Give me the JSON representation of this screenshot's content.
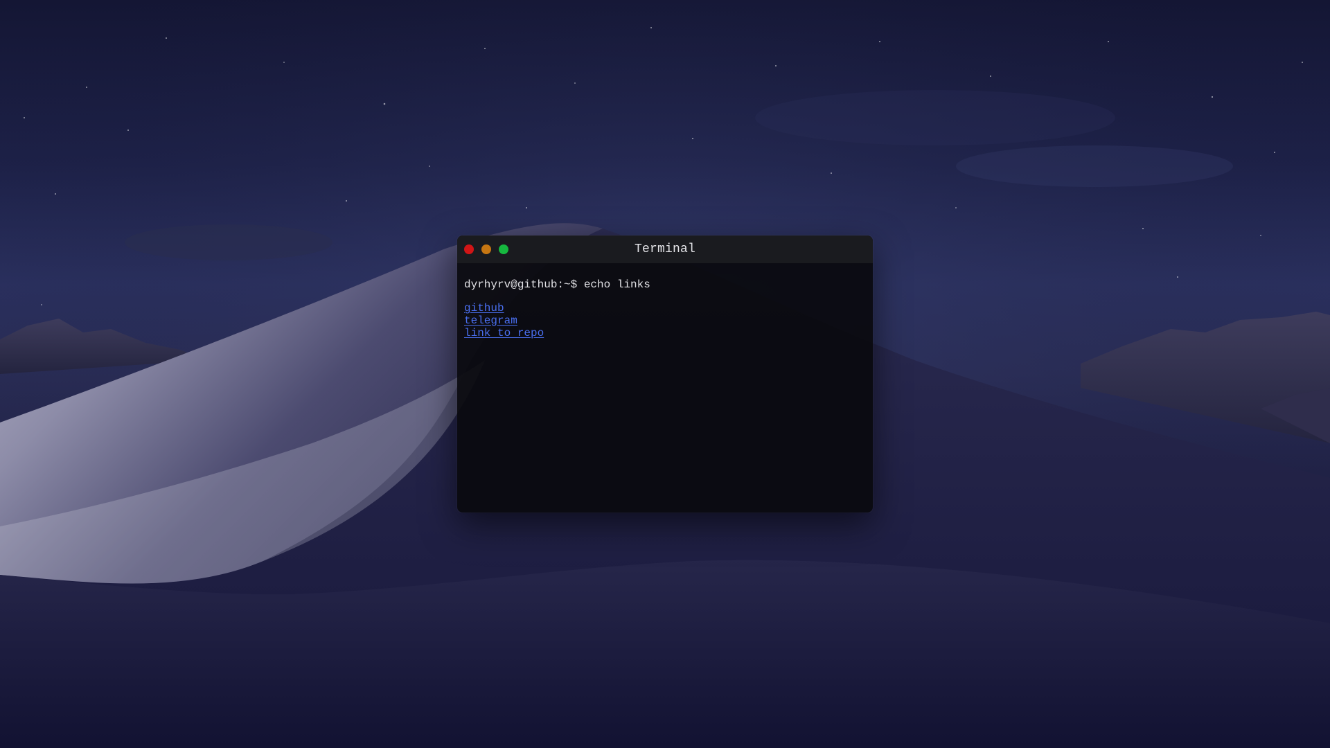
{
  "desktop": {
    "wallpaper": "mojave-night-dunes"
  },
  "window": {
    "title": "Terminal",
    "buttons": {
      "close_color": "#d11516",
      "minimize_color": "#c67612",
      "maximize_color": "#16b83f"
    }
  },
  "terminal": {
    "prompt_line": "dyrhyrv@github:~$ echo links",
    "links": [
      {
        "label": "github"
      },
      {
        "label": "telegram"
      },
      {
        "label": "link to repo"
      }
    ],
    "link_color": "#4a6ff0"
  }
}
